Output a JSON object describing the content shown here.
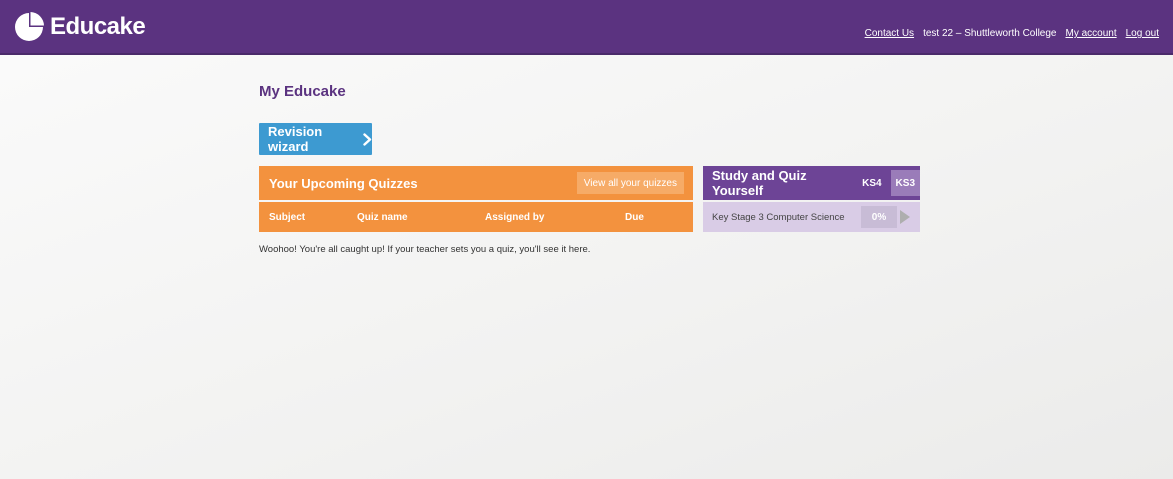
{
  "header": {
    "logo_text": "Educake",
    "nav": {
      "contact": "Contact Us",
      "user": "test 22 – Shuttleworth College",
      "account": "My account",
      "logout": "Log out"
    },
    "bg_color": "#5b3380"
  },
  "main": {
    "title": "My Educake",
    "revision_wizard_label": "Revision wizard"
  },
  "quizzes": {
    "title": "Your Upcoming Quizzes",
    "view_all_label": "View all your quizzes",
    "columns": [
      "Subject",
      "Quiz name",
      "Assigned by",
      "Due"
    ],
    "empty_message": "Woohoo! You're all caught up! If your teacher sets you a quiz, you'll see it here.",
    "color": "#f3923e"
  },
  "study": {
    "title": "Study and Quiz Yourself",
    "tabs": [
      "KS4",
      "KS3"
    ],
    "active_tab": "KS3",
    "courses": [
      {
        "name": "Key Stage 3 Computer Science",
        "progress_label": "0%",
        "progress": 0
      }
    ],
    "color": "#6d4496"
  },
  "icons": {
    "logo": "educake-pie-icon",
    "wizard": "chevron-right-icon",
    "course_start": "play-icon"
  }
}
